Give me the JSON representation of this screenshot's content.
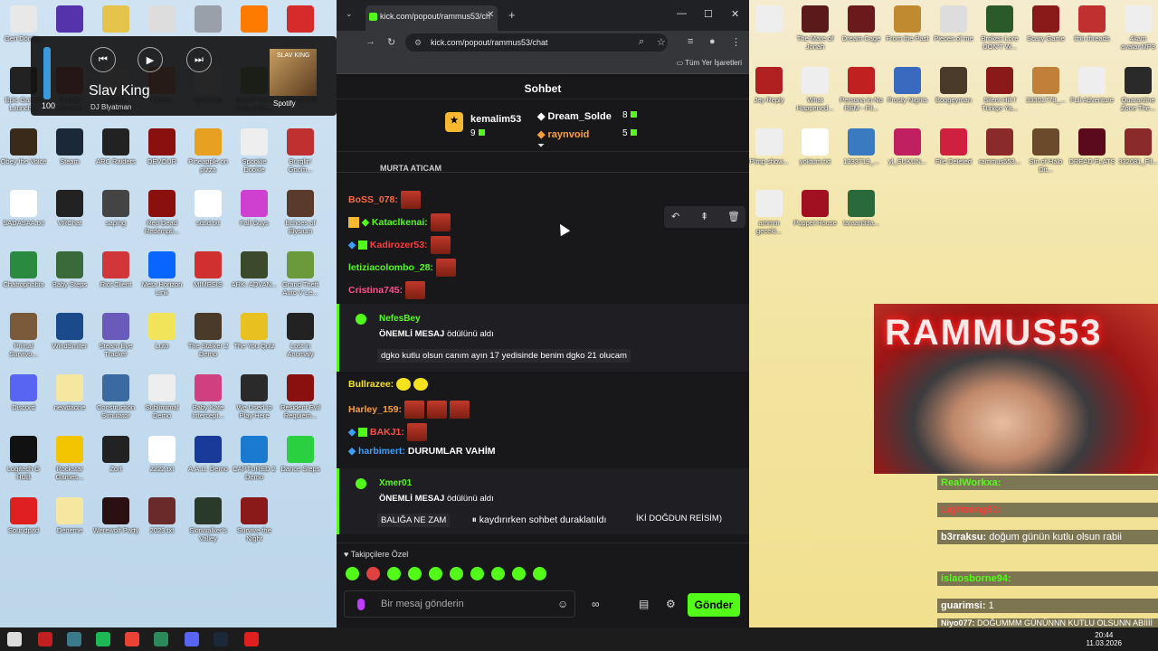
{
  "desktop": {
    "left_icons": [
      {
        "label": "Geri Dönüş..",
        "color": "#e8e8e8"
      },
      {
        "label": "",
        "color": "#5533aa"
      },
      {
        "label": "",
        "color": "#e6c34a"
      },
      {
        "label": "",
        "color": "#ddd"
      },
      {
        "label": "",
        "color": "#9aa0aa"
      },
      {
        "label": "",
        "color": "#ff7b00"
      },
      {
        "label": "",
        "color": "#d62b2b"
      },
      {
        "label": "Epic Games Launcher",
        "color": "#222"
      },
      {
        "label": "Google Chrome",
        "color": "#ea4335"
      },
      {
        "label": "isimsiz rammus...",
        "color": "#eee"
      },
      {
        "label": "Firefox",
        "color": "#ff7139"
      },
      {
        "label": "vip list.txt",
        "color": "#fff"
      },
      {
        "label": "Grand Theft Auto V En...",
        "color": "#6a9a3a"
      },
      {
        "label": "HELLMART",
        "color": "#7a2020"
      },
      {
        "label": "Obey the Voice",
        "color": "#3a2a1a"
      },
      {
        "label": "Steam",
        "color": "#1b2838"
      },
      {
        "label": "ARC Raiders",
        "color": "#222"
      },
      {
        "label": "DEVOUR",
        "color": "#8a0f0f"
      },
      {
        "label": "Pineapple on pizza",
        "color": "#e8a020"
      },
      {
        "label": "Spookie Dookie",
        "color": "#eee"
      },
      {
        "label": "Burglin' Gnom...",
        "color": "#c03030"
      },
      {
        "label": "SADASAA.txt",
        "color": "#fff"
      },
      {
        "label": "VRChat",
        "color": "#222"
      },
      {
        "label": "saping",
        "color": "#444"
      },
      {
        "label": "Red Dead Redempti...",
        "color": "#8a1010"
      },
      {
        "label": "sdsd.txt",
        "color": "#fff"
      },
      {
        "label": "Fall Guys",
        "color": "#d040d0"
      },
      {
        "label": "Echoes of Elysium",
        "color": "#5a3a2a"
      },
      {
        "label": "Chatrophobia",
        "color": "#2a8a40"
      },
      {
        "label": "Baby Steps",
        "color": "#3a6a3a"
      },
      {
        "label": "Riot Client",
        "color": "#d13639"
      },
      {
        "label": "Meta Horizon Link",
        "color": "#0866ff"
      },
      {
        "label": "MIMESIS",
        "color": "#d03030"
      },
      {
        "label": "ARK: ADVAN...",
        "color": "#3a4a2a"
      },
      {
        "label": "Grand Theft Auto V Le...",
        "color": "#6a9a3a"
      },
      {
        "label": "Primal Survivo...",
        "color": "#7a5a3a"
      },
      {
        "label": "WindSmiter",
        "color": "#1a4a8a"
      },
      {
        "label": "Steam Eye Tracker",
        "color": "#6a5aba"
      },
      {
        "label": "Luto",
        "color": "#f2e45a"
      },
      {
        "label": "The Stalker 2 Demo",
        "color": "#4a3a2a"
      },
      {
        "label": "The You Quiz",
        "color": "#e8c020"
      },
      {
        "label": "Lost in Anomaly",
        "color": "#222"
      },
      {
        "label": "Discord",
        "color": "#5865f2"
      },
      {
        "label": "newdaone",
        "color": "#f6e7a0"
      },
      {
        "label": "Construction Simulator",
        "color": "#3a6aa0"
      },
      {
        "label": "Sublimimal Demo",
        "color": "#eee"
      },
      {
        "label": "Baby Kate Intercept...",
        "color": "#d04080"
      },
      {
        "label": "We Used to Play Here",
        "color": "#2a2a2a"
      },
      {
        "label": "Resident Evil Requiem...",
        "color": "#8a1010"
      },
      {
        "label": "Logitech G HUB",
        "color": "#111"
      },
      {
        "label": "Rockstar Games...",
        "color": "#f3c400"
      },
      {
        "label": "Zort",
        "color": "#222"
      },
      {
        "label": "2222.txt",
        "color": "#fff"
      },
      {
        "label": "A.A.U. Demo",
        "color": "#1a3a9a"
      },
      {
        "label": "CAPTURED 2 Demo",
        "color": "#1a7ad0"
      },
      {
        "label": "Dance Steps",
        "color": "#2ad040"
      },
      {
        "label": "Soundpad",
        "color": "#e02020"
      },
      {
        "label": "Deneme",
        "color": "#f6e7a0"
      },
      {
        "label": "Werewolf Party",
        "color": "#2a1010"
      },
      {
        "label": "2023.txt",
        "color": "#6a2a2a"
      },
      {
        "label": "Skinwalker's Valley",
        "color": "#2a3a2a"
      },
      {
        "label": "Survive the Night",
        "color": "#8a1a1a"
      }
    ],
    "right_icons": [
      {
        "label": "",
        "color": "#eee"
      },
      {
        "label": "The Mare of Jonah",
        "color": "#5a1a1a"
      },
      {
        "label": "Dream Cage",
        "color": "#6a1a1a"
      },
      {
        "label": "From the Past",
        "color": "#c08a30"
      },
      {
        "label": "Pieces of me",
        "color": "#ddd"
      },
      {
        "label": "Broken Lore DON'T W...",
        "color": "#2a5a2a"
      },
      {
        "label": "Scary Game",
        "color": "#8a1a1a"
      },
      {
        "label": "thin threads",
        "color": "#c03030"
      },
      {
        "label": "4kam avatar.MP3",
        "color": "#eee"
      },
      {
        "label": "Jey Reply",
        "color": "#b02020"
      },
      {
        "label": "What Happened...",
        "color": "#eee"
      },
      {
        "label": "Persona in No REM - Fil...",
        "color": "#c02020"
      },
      {
        "label": "Frosty Nights",
        "color": "#3a6ac0"
      },
      {
        "label": "Boogeyman",
        "color": "#4a3a2a"
      },
      {
        "label": "Silent Hill f Türkçe Ya...",
        "color": "#8a1a1a"
      },
      {
        "label": "33301778_...",
        "color": "#c0803a"
      },
      {
        "label": "Full Adventure",
        "color": "#eee"
      },
      {
        "label": "Quarantine Zone The...",
        "color": "#2a2a2a"
      },
      {
        "label": "Pİmp show...",
        "color": "#eee"
      },
      {
        "label": "yoktum.txt",
        "color": "#fff"
      },
      {
        "label": "1333719_...",
        "color": "#3a7ac0"
      },
      {
        "label": "yl_SUKUN...",
        "color": "#c02060"
      },
      {
        "label": "File Deleted",
        "color": "#d02040"
      },
      {
        "label": "rammus553...",
        "color": "#8a2a2a"
      },
      {
        "label": "Sin of Halo Dit...",
        "color": "#6a4a2a"
      },
      {
        "label": "DREAD FLATS",
        "color": "#5a0a1a"
      },
      {
        "label": "332681_Fil...",
        "color": "#8a2a2a"
      },
      {
        "label": "ammm geceki...",
        "color": "#eee"
      },
      {
        "label": "Puppet House",
        "color": "#a01020"
      },
      {
        "label": "taraan33a...",
        "color": "#2a6a3a"
      }
    ]
  },
  "media": {
    "volume": 100,
    "volume_label": "100",
    "title": "Slav King",
    "artist": "DJ Blyatman",
    "source": "Spotify",
    "cover_text": "SLAV KING"
  },
  "browser": {
    "tab_title": "kick.com/popout/rammus53/ch",
    "url": "kick.com/popout/rammus53/chat",
    "bookmarks_label": "Tüm Yer İşaretleri"
  },
  "chat": {
    "header": "Sohbet",
    "leaderboard": [
      {
        "name": "kemalim53",
        "score": "9"
      },
      {
        "name": "Dream_Solde",
        "score": "8"
      },
      {
        "name": "raynvoid",
        "score": "5"
      }
    ],
    "pinned_cut": "MURTA ATICAM",
    "messages": [
      {
        "user": "BoSS_078:",
        "color": "#ff6a3c",
        "text": ""
      },
      {
        "user": "Kataclkenai:",
        "color": "#53fc18",
        "text": ""
      },
      {
        "user": "Kadirozer53:",
        "color": "#ff3a3a",
        "text": ""
      },
      {
        "user": "letiziacolombo_28:",
        "color": "#53fc18",
        "text": ""
      },
      {
        "user": "Cristina745:",
        "color": "#ff4f8a",
        "text": ""
      },
      {
        "user": "Bullrazee:",
        "color": "#f7e31d",
        "text": ""
      },
      {
        "user": "Harley_159:",
        "color": "#ff9d3a",
        "text": ""
      },
      {
        "user": "BAKJ1:",
        "color": "#ff4f4f",
        "text": ""
      },
      {
        "user": "harbimert:",
        "color": "#3aa0ff",
        "text": "DURUMLAR VAHİM"
      }
    ],
    "rewards": [
      {
        "user": "NefesBey",
        "reward_bold": "ÖNEMLİ MESAJ",
        "reward_rest": "ödülünü aldı",
        "text": "dgko kutlu olsun canım ayın 17 yedisinde benim dgko 21 olucam"
      },
      {
        "user": "Xmer01",
        "reward_bold": "ÖNEMLİ MESAJ",
        "reward_rest": "ödülünü aldı",
        "text_left": "BALIĞA NE ZAM",
        "text_right": "İKİ DOĞDUN REİSİM)"
      }
    ],
    "paused_text": "kaydırırken sohbet duraklatıldı",
    "followers_only": "Takipçilere Özel",
    "input_placeholder": "Bir mesaj gönderin",
    "send_label": "Gönder"
  },
  "stream": {
    "neon_sign": "RAMMUS53",
    "overlay_chat": [
      {
        "user": "RealWorkxa:",
        "text": ""
      },
      {
        "user": "Lightning51:",
        "text": ""
      },
      {
        "user": "b3rraksu:",
        "text": "doğum günün kutlu olsun rabii"
      },
      {
        "user": "islaosborne94:",
        "text": ""
      },
      {
        "user": "guarimsi:",
        "text": "1"
      },
      {
        "user": "Niyo077:",
        "text": "DOĞUMMM GÜNÜNNN KUTLU OLSUNN ABİİİİ"
      }
    ]
  },
  "taskbar": {
    "time": "20:44",
    "date": "11.03.2026"
  }
}
